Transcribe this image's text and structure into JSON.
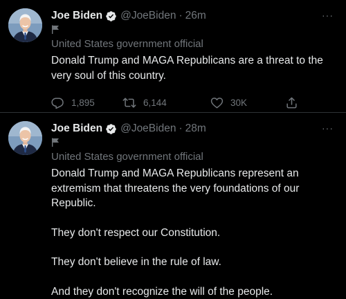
{
  "colors": {
    "background": "#000000",
    "text": "#e7e9ea",
    "muted": "#71767b",
    "divider": "#2f3336",
    "verified": "#e7e9ea"
  },
  "tweets": [
    {
      "name": "Joe Biden",
      "handle": "@JoeBiden",
      "separator": "·",
      "time": "26m",
      "more": "···",
      "label": "United States government official",
      "paragraphs": [
        "Donald Trump and MAGA Republicans are a threat to the very soul of this country."
      ],
      "replies": "1,895",
      "retweets": "6,144",
      "likes": "30K",
      "icons": [
        "verified-badge-icon",
        "government-flag-icon",
        "reply-icon",
        "retweet-icon",
        "like-icon",
        "share-icon"
      ]
    },
    {
      "name": "Joe Biden",
      "handle": "@JoeBiden",
      "separator": "·",
      "time": "28m",
      "more": "···",
      "label": "United States government official",
      "paragraphs": [
        "Donald Trump and MAGA Republicans represent an extremism that threatens the very foundations of our Republic.",
        "They don't respect our Constitution.",
        "They don't believe in the rule of law.",
        "And they don't recognize the will of the people."
      ],
      "icons": [
        "verified-badge-icon",
        "government-flag-icon"
      ]
    }
  ]
}
